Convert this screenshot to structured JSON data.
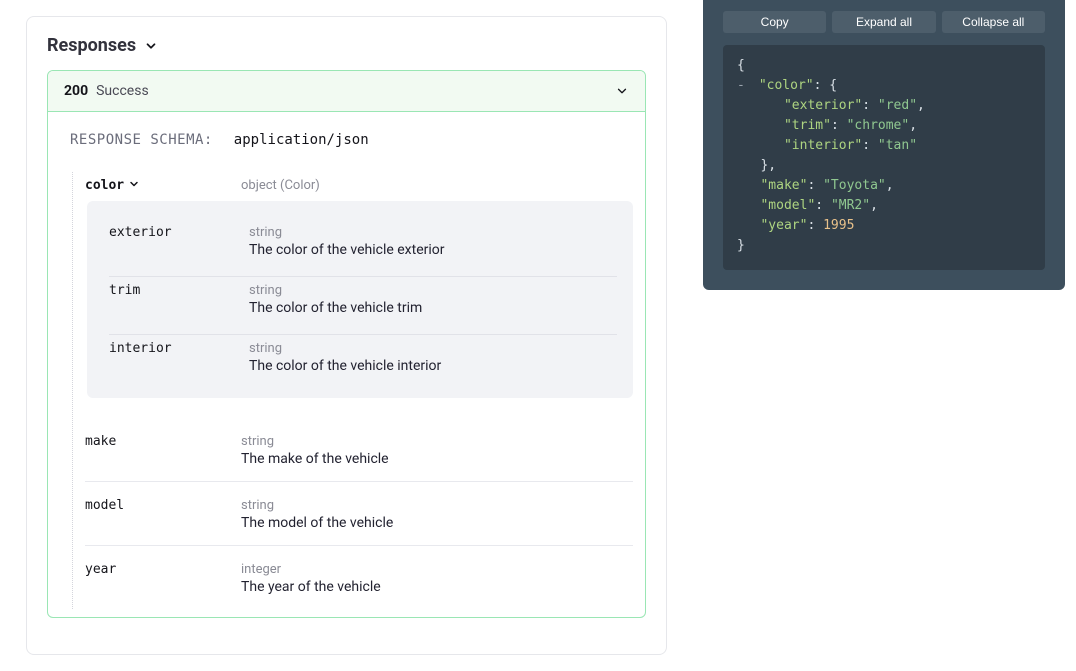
{
  "section": {
    "title": "Responses"
  },
  "response": {
    "code": "200",
    "label": "Success",
    "schema_label": "RESPONSE SCHEMA:",
    "mime": "application/json"
  },
  "props": {
    "color": {
      "name": "color",
      "type": "object (Color)",
      "children": {
        "exterior": {
          "name": "exterior",
          "type": "string",
          "desc": "The color of the vehicle exterior"
        },
        "trim": {
          "name": "trim",
          "type": "string",
          "desc": "The color of the vehicle trim"
        },
        "interior": {
          "name": "interior",
          "type": "string",
          "desc": "The color of the vehicle interior"
        }
      }
    },
    "make": {
      "name": "make",
      "type": "string",
      "desc": "The make of the vehicle"
    },
    "model": {
      "name": "model",
      "type": "string",
      "desc": "The model of the vehicle"
    },
    "year": {
      "name": "year",
      "type": "integer",
      "desc": "The year of the vehicle"
    }
  },
  "samplebar": {
    "copy": "Copy",
    "expand": "Expand all",
    "collapse": "Collapse all"
  },
  "sample": {
    "color_exterior": "\"red\"",
    "color_trim": "\"chrome\"",
    "color_interior": "\"tan\"",
    "make": "\"Toyota\"",
    "model": "\"MR2\"",
    "year": "1995"
  }
}
